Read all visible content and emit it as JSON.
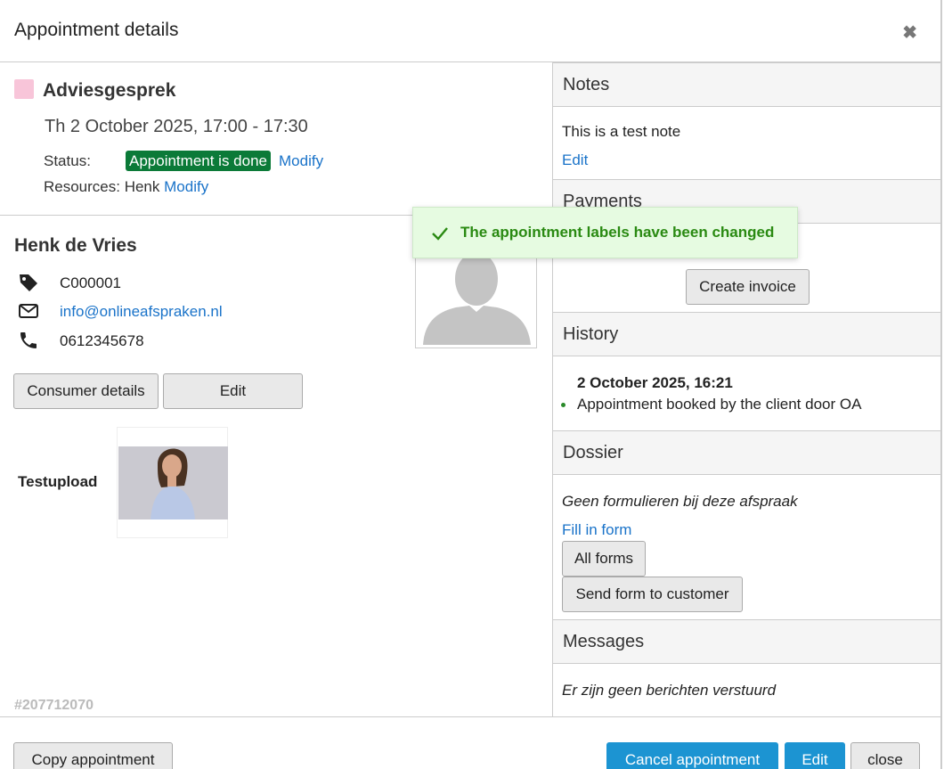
{
  "header": {
    "title": "Appointment details",
    "close_glyph": "✖"
  },
  "appointment": {
    "name": "Adviesgesprek",
    "color": "#f8c5d9",
    "datetime": "Th 2 October 2025, 17:00 - 17:30",
    "status_label": "Status:",
    "status_value": "Appointment is done",
    "status_modify": "Modify",
    "resources_label": "Resources: Henk",
    "resources_modify": "Modify",
    "id": "#207712070"
  },
  "customer": {
    "name": "Henk de Vries",
    "number": "C000001",
    "email": "info@onlineafspraken.nl",
    "phone": "0612345678",
    "consumer_details_label": "Consumer details",
    "edit_label": "Edit",
    "upload_label": "Testupload"
  },
  "toast": {
    "message": "The appointment labels have been changed"
  },
  "notes": {
    "title": "Notes",
    "text": "This is a test note",
    "edit_label": "Edit"
  },
  "payments": {
    "title": "Payments",
    "create_invoice_label": "Create invoice"
  },
  "history": {
    "title": "History",
    "date": "2 October 2025, 16:21",
    "items": [
      "Appointment booked by the client door OA"
    ]
  },
  "dossier": {
    "title": "Dossier",
    "empty_text": "Geen formulieren bij deze afspraak",
    "fill_in_form": "Fill in form",
    "all_forms": "All forms",
    "send_form": "Send form to customer"
  },
  "messages": {
    "title": "Messages",
    "empty_text": "Er zijn geen berichten verstuurd"
  },
  "footer": {
    "copy_label": "Copy appointment",
    "cancel_label": "Cancel appointment",
    "edit_label": "Edit",
    "close_label": "close"
  },
  "icons": [
    "tag-icon",
    "mail-icon",
    "phone-icon",
    "check-icon",
    "close-icon",
    "avatar-placeholder-icon"
  ]
}
